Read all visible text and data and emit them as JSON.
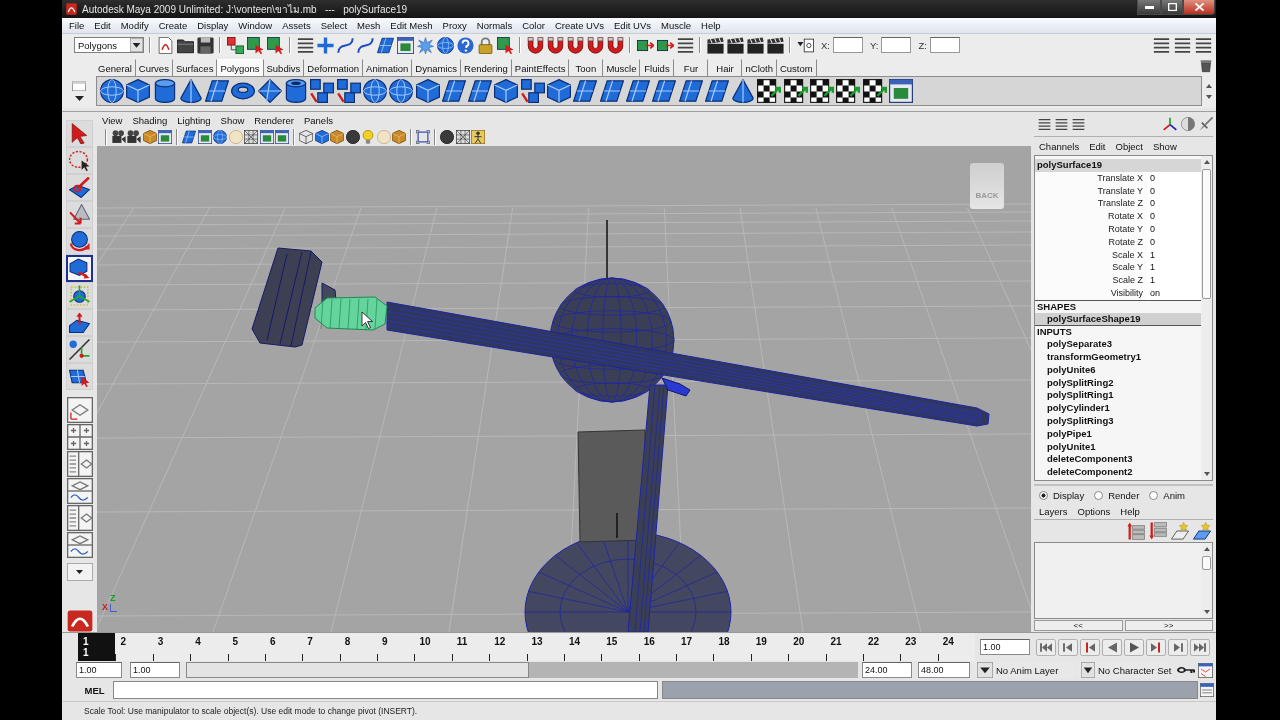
{
  "window": {
    "title": "Autodesk Maya 2009 Unlimited: J:\\vonteen\\ขาไม.mb   ---   polySurface19"
  },
  "menu_bar": [
    "File",
    "Edit",
    "Modify",
    "Create",
    "Display",
    "Window",
    "Assets",
    "Select",
    "Mesh",
    "Edit Mesh",
    "Proxy",
    "Normals",
    "Color",
    "Create UVs",
    "Edit UVs",
    "Muscle",
    "Help"
  ],
  "status_line": {
    "menu_set": "Polygons",
    "coordinates": [
      {
        "label": "X:"
      },
      {
        "label": "Y:"
      },
      {
        "label": "Z:"
      }
    ]
  },
  "shelf": {
    "tabs": [
      {
        "label": "General",
        "selected": false
      },
      {
        "label": "Curves",
        "selected": false
      },
      {
        "label": "Surfaces",
        "selected": false
      },
      {
        "label": "Polygons",
        "selected": true
      },
      {
        "label": "Subdivs",
        "selected": false
      },
      {
        "label": "Deformation",
        "selected": false
      },
      {
        "label": "Animation",
        "selected": false
      },
      {
        "label": "Dynamics",
        "selected": false
      },
      {
        "label": "Rendering",
        "selected": false
      },
      {
        "label": "PaintEffects",
        "selected": false
      },
      {
        "label": "Toon",
        "selected": false
      },
      {
        "label": "Muscle",
        "selected": false
      },
      {
        "label": "Fluids",
        "selected": false
      },
      {
        "label": "Fur",
        "selected": false
      },
      {
        "label": "Hair",
        "selected": false
      },
      {
        "label": "nCloth",
        "selected": false
      },
      {
        "label": "Custom",
        "selected": false
      }
    ]
  },
  "toolbox": {
    "tools": [
      {
        "kind": "select",
        "selected": false
      },
      {
        "kind": "lasso",
        "selected": false
      },
      {
        "kind": "paint",
        "selected": false
      },
      {
        "kind": "move",
        "selected": false
      },
      {
        "kind": "rotate",
        "selected": false
      },
      {
        "kind": "scale",
        "selected": true
      },
      {
        "kind": "universal",
        "selected": false
      },
      {
        "kind": "soft_mod",
        "selected": false
      },
      {
        "kind": "show_manip",
        "selected": false
      },
      {
        "kind": "last_tool",
        "selected": false
      }
    ]
  },
  "viewport": {
    "menus": [
      "View",
      "Shading",
      "Lighting",
      "Show",
      "Renderer",
      "Panels"
    ],
    "view_cube": "BACK",
    "axes": [
      {
        "label": "X",
        "color": "#d01818"
      },
      {
        "label": "Z",
        "color": "#18a020"
      }
    ]
  },
  "channel_box": {
    "menus": [
      "Channels",
      "Edit",
      "Object",
      "Show"
    ],
    "object": "polySurface19",
    "attributes": [
      {
        "name": "Translate X",
        "value": "0"
      },
      {
        "name": "Translate Y",
        "value": "0"
      },
      {
        "name": "Translate Z",
        "value": "0"
      },
      {
        "name": "Rotate X",
        "value": "0"
      },
      {
        "name": "Rotate Y",
        "value": "0"
      },
      {
        "name": "Rotate Z",
        "value": "0"
      },
      {
        "name": "Scale X",
        "value": "1"
      },
      {
        "name": "Scale Y",
        "value": "1"
      },
      {
        "name": "Scale Z",
        "value": "1"
      },
      {
        "name": "Visibility",
        "value": "on"
      }
    ],
    "shapes_heading": "SHAPES",
    "shapes": [
      {
        "name": "polySurfaceShape19",
        "selected": true
      }
    ],
    "inputs_heading": "INPUTS",
    "inputs": [
      {
        "name": "polySeparate3",
        "selected": false
      },
      {
        "name": "transformGeometry1",
        "selected": false
      },
      {
        "name": "polyUnite6",
        "selected": false
      },
      {
        "name": "polySplitRing2",
        "selected": false
      },
      {
        "name": "polySplitRing1",
        "selected": false
      },
      {
        "name": "polyCylinder1",
        "selected": false
      },
      {
        "name": "polySplitRing3",
        "selected": false
      },
      {
        "name": "polyPipe1",
        "selected": false
      },
      {
        "name": "polyUnite1",
        "selected": false
      },
      {
        "name": "deleteComponent3",
        "selected": false
      },
      {
        "name": "deleteComponent2",
        "selected": false
      }
    ]
  },
  "layer_editor": {
    "modes": [
      {
        "label": "Display",
        "selected": true
      },
      {
        "label": "Render",
        "selected": false
      },
      {
        "label": "Anim",
        "selected": false
      }
    ],
    "menus": [
      "Layers",
      "Options",
      "Help"
    ],
    "pager": [
      "<<",
      ">>"
    ]
  },
  "time_slider": {
    "frames": [
      {
        "label": "1",
        "selected": true
      },
      {
        "label": "2",
        "selected": false
      },
      {
        "label": "3",
        "selected": false
      },
      {
        "label": "4",
        "selected": false
      },
      {
        "label": "5",
        "selected": false
      },
      {
        "label": "6",
        "selected": false
      },
      {
        "label": "7",
        "selected": false
      },
      {
        "label": "8",
        "selected": false
      },
      {
        "label": "9",
        "selected": false
      },
      {
        "label": "10",
        "selected": false
      },
      {
        "label": "11",
        "selected": false
      },
      {
        "label": "12",
        "selected": false
      },
      {
        "label": "13",
        "selected": false
      },
      {
        "label": "14",
        "selected": false
      },
      {
        "label": "15",
        "selected": false
      },
      {
        "label": "16",
        "selected": false
      },
      {
        "label": "17",
        "selected": false
      },
      {
        "label": "18",
        "selected": false
      },
      {
        "label": "19",
        "selected": false
      },
      {
        "label": "20",
        "selected": false
      },
      {
        "label": "21",
        "selected": false
      },
      {
        "label": "22",
        "selected": false
      },
      {
        "label": "23",
        "selected": false
      },
      {
        "label": "24",
        "selected": false
      }
    ],
    "current_frame": "1",
    "current_time": "1.00"
  },
  "range_slider": {
    "start": "1.00",
    "range_start": "1.00",
    "level": 0.51,
    "range_end": "24.00",
    "end": "48.00",
    "anim_layer": "No Anim Layer",
    "character_set": "No Character Set"
  },
  "command_line": {
    "language": "MEL"
  },
  "help_line": "Scale Tool: Use manipulator to scale object(s). Use edit mode to change pivot (INSERT)."
}
